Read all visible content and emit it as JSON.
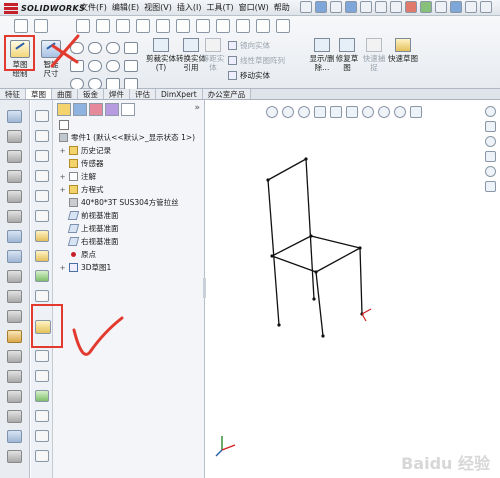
{
  "app": {
    "logo_text": "SOLIDWORKS",
    "menus": [
      "文件(F)",
      "编辑(E)",
      "视图(V)",
      "插入(I)",
      "工具(T)",
      "窗口(W)",
      "帮助"
    ]
  },
  "ribbon": {
    "sketch_button": "草图绘制",
    "smart_dim_button": "智能尺寸",
    "trim_button": "剪裁实体(T)",
    "convert_button": "转换实体引用",
    "offset_button": "等距实体",
    "mirror_label": "镜向实体",
    "linear_pattern_label": "线性草图阵列",
    "move_label": "移动实体",
    "display_delete_button": "显示/删除...",
    "repair_button": "修复草图",
    "quick_snap_button": "快速捕捉",
    "rapid_sketch_button": "快速草图"
  },
  "tabs": [
    "特征",
    "草图",
    "曲面",
    "钣金",
    "焊件",
    "评估",
    "DimXpert",
    "办公室产品"
  ],
  "tree": {
    "root": "零件1 (默认<<默认>_显示状态 1>)",
    "items": [
      "历史记录",
      "传感器",
      "注解",
      "方程式",
      "40*80*3T  SUS304方管拉丝",
      "前视基准面",
      "上视基准面",
      "右视基准面",
      "原点",
      "3D草图1"
    ]
  },
  "viewport": {
    "watermark": "Baidu 经验"
  },
  "colors": {
    "annotation_red": "#e23a2e",
    "sketch_line": "#111111",
    "origin_red": "#d21f1f"
  },
  "icons": {
    "title_logo": "solidworks-logo",
    "sketch": "sketch-icon",
    "smart_dimension": "smart-dimension-icon"
  }
}
